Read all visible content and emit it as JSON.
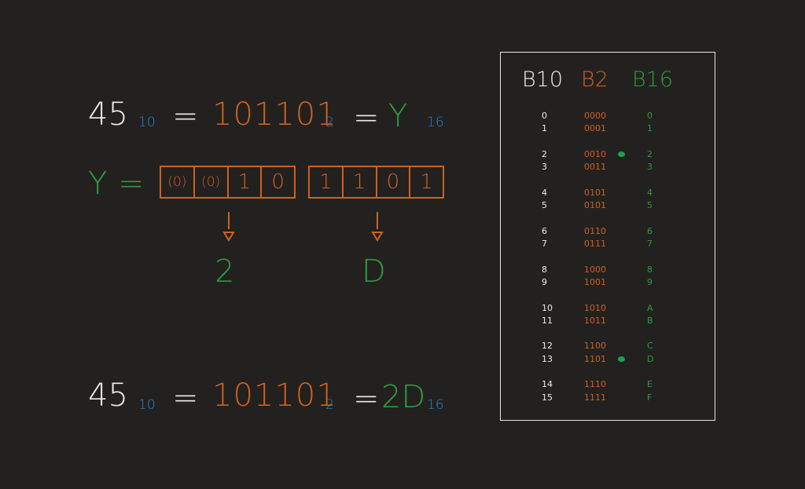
{
  "colors": {
    "white": "#ececec",
    "orange": "#d0601e",
    "green": "#2f9a3e",
    "blue": "#2c86c8",
    "background": "#222120"
  },
  "top_equation": {
    "decimal": "45",
    "decimal_base": "10",
    "eq1": "=",
    "binary": "101101",
    "binary_base": "2",
    "eq2": "=",
    "hex": "Y",
    "hex_base": "16"
  },
  "grouping": {
    "variable": "Y",
    "eq": "=",
    "group1": [
      "(0)",
      "(0)",
      "1",
      "0"
    ],
    "group2": [
      "1",
      "1",
      "0",
      "1"
    ],
    "result1": "2",
    "result2": "D"
  },
  "bottom_equation": {
    "decimal": "45",
    "decimal_base": "10",
    "eq1": "=",
    "binary": "101101",
    "binary_base": "2",
    "eq2": "=",
    "hex": "2D",
    "hex_base": "16"
  },
  "table": {
    "headers": [
      "B10",
      "B2",
      "B16"
    ],
    "rows": [
      {
        "b10": "0",
        "b2": "0000",
        "b16": "0"
      },
      {
        "b10": "1",
        "b2": "0001",
        "b16": "1"
      },
      {
        "b10": "2",
        "b2": "0010",
        "b16": "2"
      },
      {
        "b10": "3",
        "b2": "0011",
        "b16": "3"
      },
      {
        "b10": "4",
        "b2": "0101",
        "b16": "4"
      },
      {
        "b10": "5",
        "b2": "0101",
        "b16": "5"
      },
      {
        "b10": "6",
        "b2": "0110",
        "b16": "6"
      },
      {
        "b10": "7",
        "b2": "0111",
        "b16": "7"
      },
      {
        "b10": "8",
        "b2": "1000",
        "b16": "8"
      },
      {
        "b10": "9",
        "b2": "1001",
        "b16": "9"
      },
      {
        "b10": "10",
        "b2": "1010",
        "b16": "A"
      },
      {
        "b10": "11",
        "b2": "1011",
        "b16": "B"
      },
      {
        "b10": "12",
        "b2": "1100",
        "b16": "C"
      },
      {
        "b10": "13",
        "b2": "1101",
        "b16": "D"
      },
      {
        "b10": "14",
        "b2": "1110",
        "b16": "E"
      },
      {
        "b10": "15",
        "b2": "1111",
        "b16": "F"
      }
    ],
    "highlighted_rows": [
      "2",
      "13"
    ]
  }
}
